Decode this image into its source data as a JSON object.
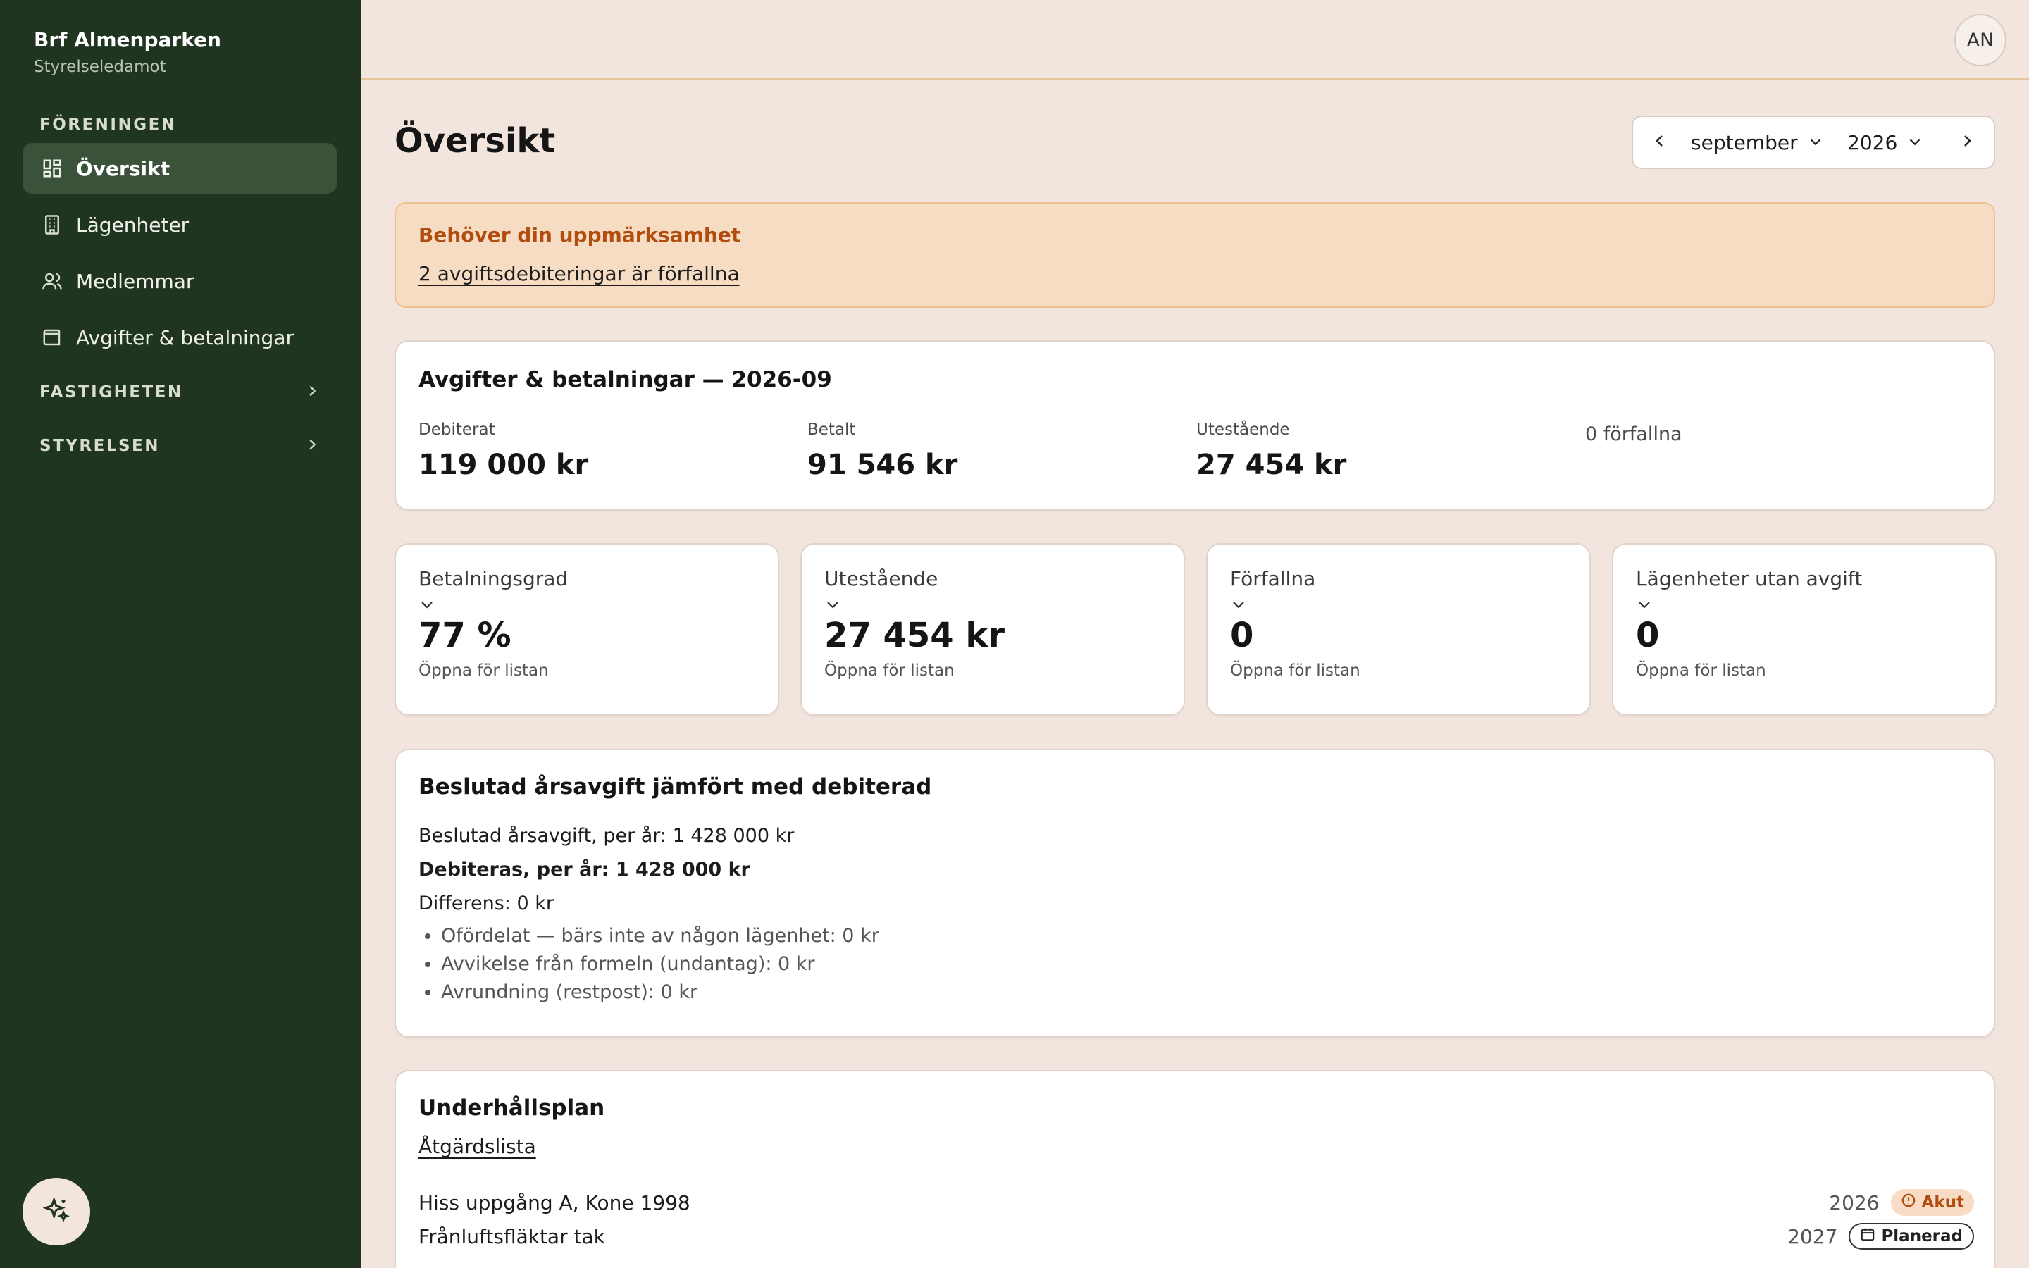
{
  "sidebar": {
    "org_name": "Brf Almenparken",
    "org_role": "Styrelseledamot",
    "section_foreningen": "FÖRENINGEN",
    "items": [
      {
        "label": "Översikt",
        "icon": "dashboard-icon",
        "active": true
      },
      {
        "label": "Lägenheter",
        "icon": "building-icon"
      },
      {
        "label": "Medlemmar",
        "icon": "users-icon"
      },
      {
        "label": "Avgifter & betalningar",
        "icon": "wallet-icon"
      }
    ],
    "section_fastigheten": "FASTIGHETEN",
    "section_styrelsen": "STYRELSEN"
  },
  "header": {
    "avatar_initials": "AN"
  },
  "main": {
    "title": "Översikt",
    "period": {
      "month": "september",
      "year": "2026"
    },
    "alert": {
      "title": "Behöver din uppmärksamhet",
      "link": "2 avgiftsdebiteringar är förfallna"
    },
    "summary": {
      "title": "Avgifter & betalningar — 2026-09",
      "debited_label": "Debiterat",
      "debited_value": "119 000 kr",
      "paid_label": "Betalt",
      "paid_value": "91 546 kr",
      "outstanding_label": "Utestående",
      "outstanding_value": "27 454 kr",
      "overdue_note": "0 förfallna"
    },
    "kpis": [
      {
        "label": "Betalningsgrad",
        "value": "77 %",
        "hint": "Öppna för listan"
      },
      {
        "label": "Utestående",
        "value": "27 454 kr",
        "hint": "Öppna för listan"
      },
      {
        "label": "Förfallna",
        "value": "0",
        "hint": "Öppna för listan"
      },
      {
        "label": "Lägenheter utan avgift",
        "value": "0",
        "hint": "Öppna för listan"
      }
    ],
    "fee_compare": {
      "title": "Beslutad årsavgift jämfört med debiterad",
      "line1": "Beslutad årsavgift, per år: 1 428 000 kr",
      "line2": "Debiteras, per år: 1 428 000 kr",
      "line3": "Differens: 0 kr",
      "bullets": [
        "Ofördelat — bärs inte av någon lägenhet: 0 kr",
        "Avvikelse från formeln (undantag): 0 kr",
        "Avrundning (restpost): 0 kr"
      ]
    },
    "maintenance": {
      "title": "Underhållsplan",
      "link": "Åtgärdslista",
      "rows": [
        {
          "name": "Hiss uppgång A, Kone 1998",
          "year": "2026",
          "badge": "Akut",
          "badge_icon": "alert-circle-icon"
        },
        {
          "name": "Frånluftsfläktar tak",
          "year": "2027",
          "badge": "Planerad",
          "badge_icon": "calendar-icon"
        }
      ]
    }
  },
  "colors": {
    "sidebar_bg": "#1f3520",
    "page_bg": "#f2e5dd",
    "accent_warning": "#b14d0f",
    "alert_bg": "#f5dcc2"
  }
}
